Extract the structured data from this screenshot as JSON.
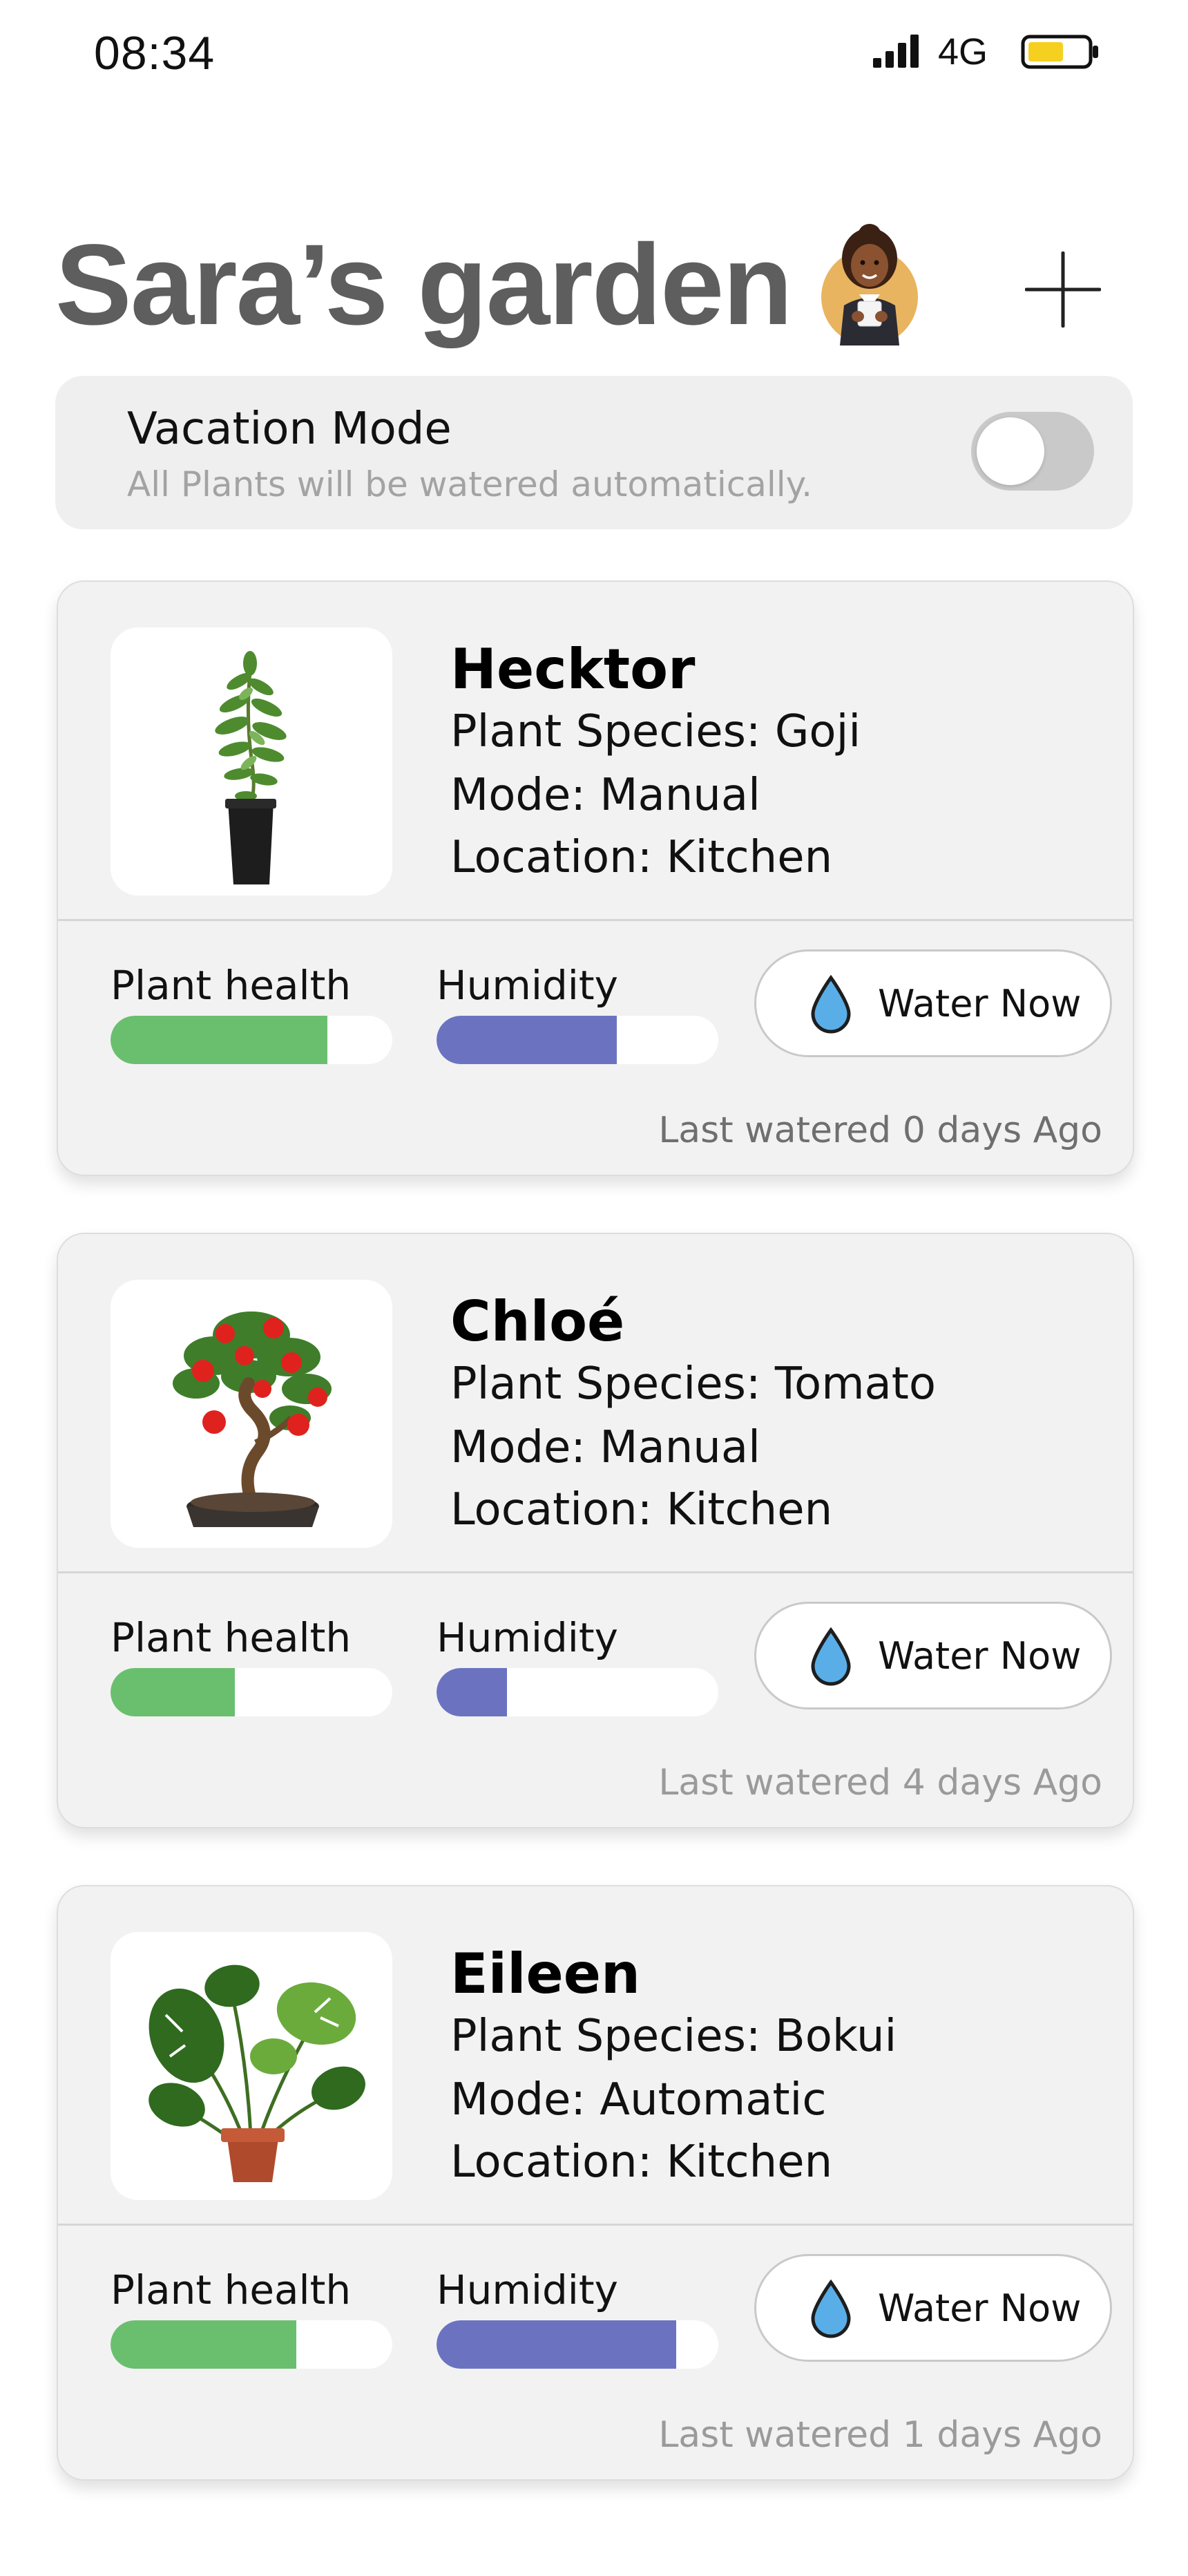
{
  "status_bar": {
    "time": "08:34",
    "network": "4G",
    "battery_color": "#f5d020"
  },
  "header": {
    "title": "Sara’s garden",
    "avatar_icon": "woman-avatar-icon",
    "add_icon": "plus-icon"
  },
  "vacation": {
    "title": "Vacation Mode",
    "subtitle": "All Plants will be watered automatically.",
    "enabled": false
  },
  "metric_labels": {
    "health": "Plant health",
    "humidity": "Humidity"
  },
  "colors": {
    "health": "#6abf6e",
    "humidity": "#6b73c1",
    "water_drop": "#5aaee8"
  },
  "plants": [
    {
      "name": "Hecktor",
      "species": "Plant Species: Goji",
      "mode": "Mode: Manual",
      "location": "Location: Kitchen",
      "image_icon": "goji-plant-icon",
      "health": 0.77,
      "humidity": 0.64,
      "button_label": "Water Now",
      "last_watered": "Last watered 0 days Ago"
    },
    {
      "name": "Chloé",
      "species": "Plant Species: Tomato",
      "mode": "Mode: Manual",
      "location": "Location: Kitchen",
      "image_icon": "tomato-bonsai-icon",
      "health": 0.44,
      "humidity": 0.25,
      "button_label": "Water Now",
      "last_watered": "Last watered 4 days Ago"
    },
    {
      "name": "Eileen",
      "species": "Plant Species: Bokui",
      "mode": "Mode: Automatic",
      "location": "Location: Kitchen",
      "image_icon": "monstera-plant-icon",
      "health": 0.66,
      "humidity": 0.85,
      "button_label": "Water Now",
      "last_watered": "Last watered 1 days Ago"
    }
  ]
}
